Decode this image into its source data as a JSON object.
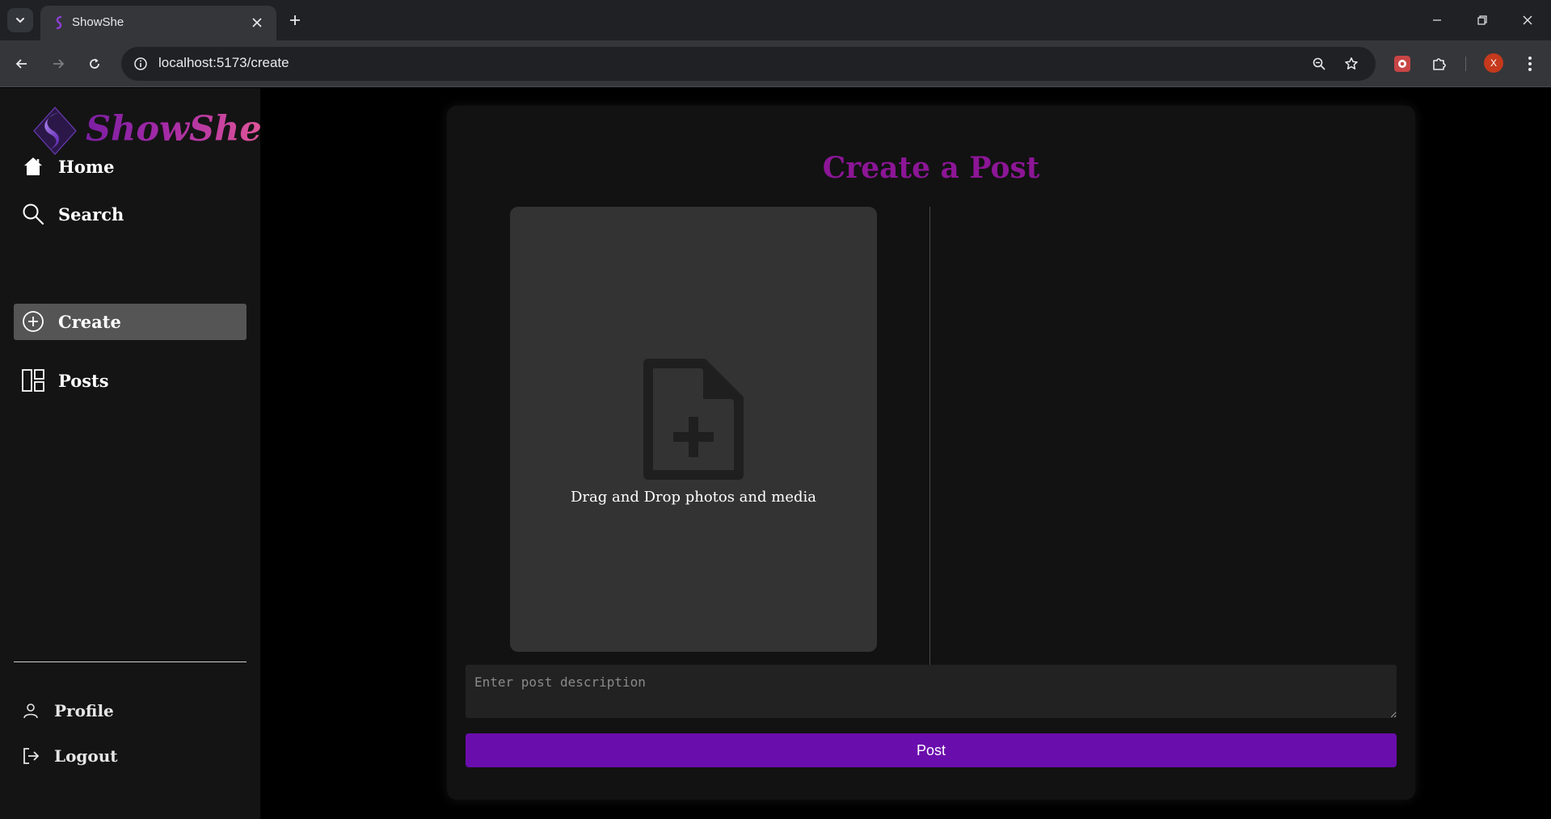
{
  "browser": {
    "tab_title": "ShowShe",
    "url": "localhost:5173/create",
    "profile_initial": "X"
  },
  "sidebar": {
    "brand": "ShowShe",
    "nav": [
      {
        "label": "Home",
        "icon": "home-icon",
        "active": false
      },
      {
        "label": "Search",
        "icon": "search-icon",
        "active": false
      },
      {
        "label": "Create",
        "icon": "plus-circle-icon",
        "active": true
      },
      {
        "label": "Posts",
        "icon": "layout-icon",
        "active": false
      }
    ],
    "bottom": [
      {
        "label": "Profile",
        "icon": "user-icon"
      },
      {
        "label": "Logout",
        "icon": "logout-icon"
      }
    ]
  },
  "create_post": {
    "title": "Create a Post",
    "dropzone_text": "Drag and Drop photos and media",
    "description_placeholder": "Enter post description",
    "submit_label": "Post"
  },
  "colors": {
    "title": "#8c1696",
    "button": "#6a0dad",
    "active_nav": "#555555"
  }
}
